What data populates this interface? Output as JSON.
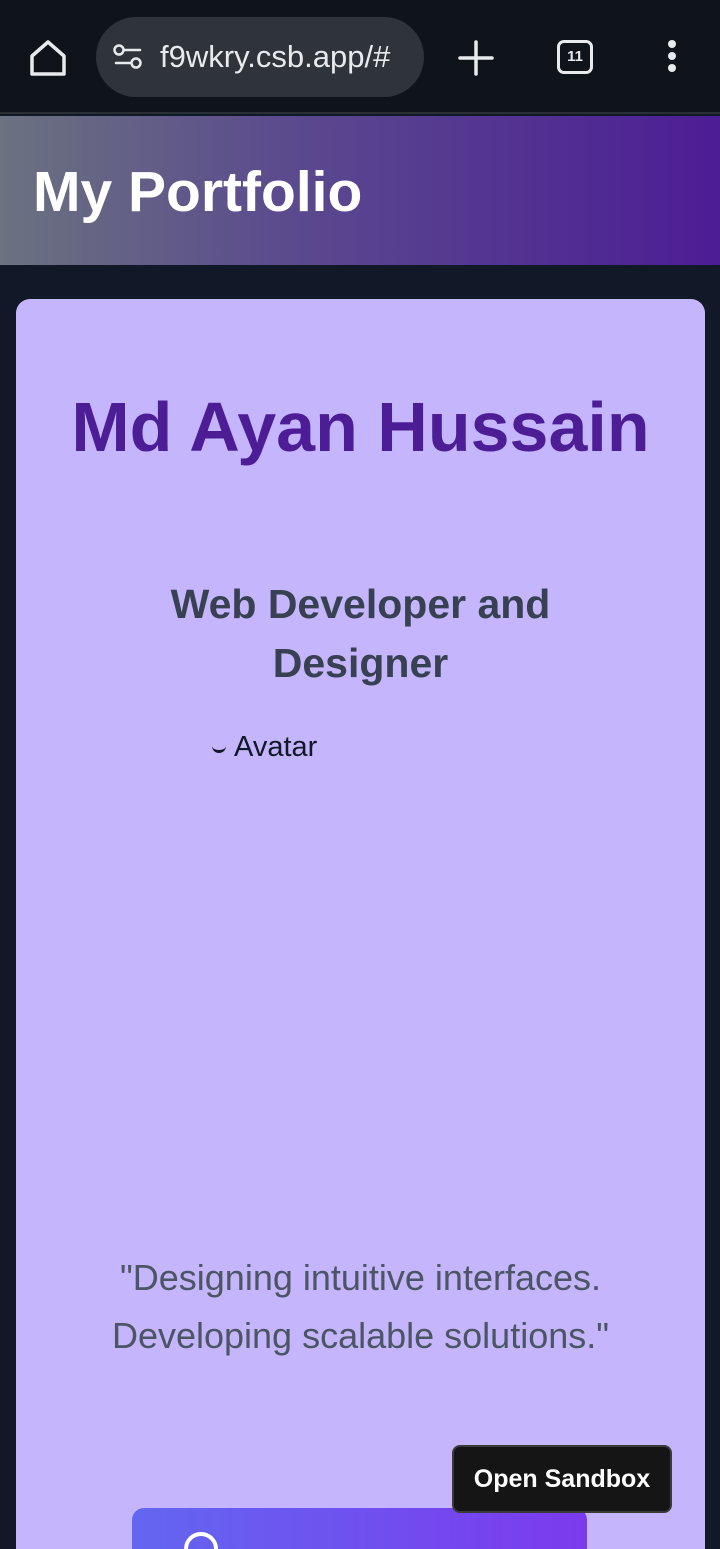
{
  "browser": {
    "url": "f9wkry.csb.app/#",
    "tab_count": "11"
  },
  "header": {
    "title": "My Portfolio"
  },
  "profile": {
    "name": "Md Ayan Hussain",
    "role": "Web Developer and Designer",
    "avatar_alt": "Avatar",
    "tagline": "\"Designing intuitive interfaces. Developing scalable solutions.\""
  },
  "sandbox": {
    "button_label": "Open Sandbox"
  },
  "colors": {
    "header_gradient_start": "#6b7280",
    "header_gradient_end": "#4c1d95",
    "card_background": "#c4b5fd",
    "name_color": "#4c1d95",
    "page_background": "#111827"
  }
}
